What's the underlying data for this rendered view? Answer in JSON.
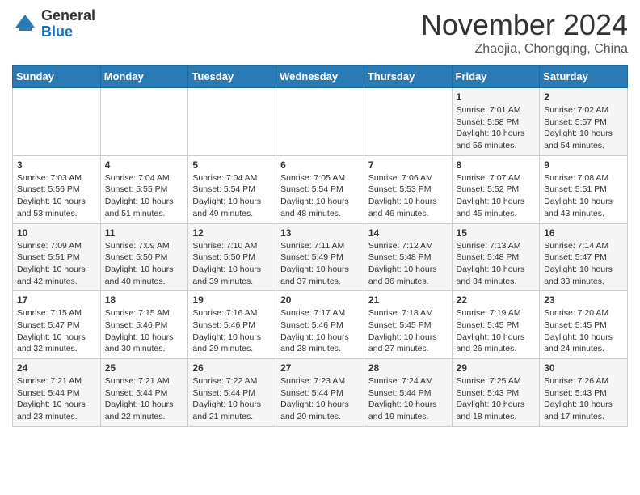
{
  "header": {
    "logo_general": "General",
    "logo_blue": "Blue",
    "month_title": "November 2024",
    "subtitle": "Zhaojia, Chongqing, China"
  },
  "weekdays": [
    "Sunday",
    "Monday",
    "Tuesday",
    "Wednesday",
    "Thursday",
    "Friday",
    "Saturday"
  ],
  "weeks": [
    [
      {
        "day": "",
        "info": ""
      },
      {
        "day": "",
        "info": ""
      },
      {
        "day": "",
        "info": ""
      },
      {
        "day": "",
        "info": ""
      },
      {
        "day": "",
        "info": ""
      },
      {
        "day": "1",
        "info": "Sunrise: 7:01 AM\nSunset: 5:58 PM\nDaylight: 10 hours\nand 56 minutes."
      },
      {
        "day": "2",
        "info": "Sunrise: 7:02 AM\nSunset: 5:57 PM\nDaylight: 10 hours\nand 54 minutes."
      }
    ],
    [
      {
        "day": "3",
        "info": "Sunrise: 7:03 AM\nSunset: 5:56 PM\nDaylight: 10 hours\nand 53 minutes."
      },
      {
        "day": "4",
        "info": "Sunrise: 7:04 AM\nSunset: 5:55 PM\nDaylight: 10 hours\nand 51 minutes."
      },
      {
        "day": "5",
        "info": "Sunrise: 7:04 AM\nSunset: 5:54 PM\nDaylight: 10 hours\nand 49 minutes."
      },
      {
        "day": "6",
        "info": "Sunrise: 7:05 AM\nSunset: 5:54 PM\nDaylight: 10 hours\nand 48 minutes."
      },
      {
        "day": "7",
        "info": "Sunrise: 7:06 AM\nSunset: 5:53 PM\nDaylight: 10 hours\nand 46 minutes."
      },
      {
        "day": "8",
        "info": "Sunrise: 7:07 AM\nSunset: 5:52 PM\nDaylight: 10 hours\nand 45 minutes."
      },
      {
        "day": "9",
        "info": "Sunrise: 7:08 AM\nSunset: 5:51 PM\nDaylight: 10 hours\nand 43 minutes."
      }
    ],
    [
      {
        "day": "10",
        "info": "Sunrise: 7:09 AM\nSunset: 5:51 PM\nDaylight: 10 hours\nand 42 minutes."
      },
      {
        "day": "11",
        "info": "Sunrise: 7:09 AM\nSunset: 5:50 PM\nDaylight: 10 hours\nand 40 minutes."
      },
      {
        "day": "12",
        "info": "Sunrise: 7:10 AM\nSunset: 5:50 PM\nDaylight: 10 hours\nand 39 minutes."
      },
      {
        "day": "13",
        "info": "Sunrise: 7:11 AM\nSunset: 5:49 PM\nDaylight: 10 hours\nand 37 minutes."
      },
      {
        "day": "14",
        "info": "Sunrise: 7:12 AM\nSunset: 5:48 PM\nDaylight: 10 hours\nand 36 minutes."
      },
      {
        "day": "15",
        "info": "Sunrise: 7:13 AM\nSunset: 5:48 PM\nDaylight: 10 hours\nand 34 minutes."
      },
      {
        "day": "16",
        "info": "Sunrise: 7:14 AM\nSunset: 5:47 PM\nDaylight: 10 hours\nand 33 minutes."
      }
    ],
    [
      {
        "day": "17",
        "info": "Sunrise: 7:15 AM\nSunset: 5:47 PM\nDaylight: 10 hours\nand 32 minutes."
      },
      {
        "day": "18",
        "info": "Sunrise: 7:15 AM\nSunset: 5:46 PM\nDaylight: 10 hours\nand 30 minutes."
      },
      {
        "day": "19",
        "info": "Sunrise: 7:16 AM\nSunset: 5:46 PM\nDaylight: 10 hours\nand 29 minutes."
      },
      {
        "day": "20",
        "info": "Sunrise: 7:17 AM\nSunset: 5:46 PM\nDaylight: 10 hours\nand 28 minutes."
      },
      {
        "day": "21",
        "info": "Sunrise: 7:18 AM\nSunset: 5:45 PM\nDaylight: 10 hours\nand 27 minutes."
      },
      {
        "day": "22",
        "info": "Sunrise: 7:19 AM\nSunset: 5:45 PM\nDaylight: 10 hours\nand 26 minutes."
      },
      {
        "day": "23",
        "info": "Sunrise: 7:20 AM\nSunset: 5:45 PM\nDaylight: 10 hours\nand 24 minutes."
      }
    ],
    [
      {
        "day": "24",
        "info": "Sunrise: 7:21 AM\nSunset: 5:44 PM\nDaylight: 10 hours\nand 23 minutes."
      },
      {
        "day": "25",
        "info": "Sunrise: 7:21 AM\nSunset: 5:44 PM\nDaylight: 10 hours\nand 22 minutes."
      },
      {
        "day": "26",
        "info": "Sunrise: 7:22 AM\nSunset: 5:44 PM\nDaylight: 10 hours\nand 21 minutes."
      },
      {
        "day": "27",
        "info": "Sunrise: 7:23 AM\nSunset: 5:44 PM\nDaylight: 10 hours\nand 20 minutes."
      },
      {
        "day": "28",
        "info": "Sunrise: 7:24 AM\nSunset: 5:44 PM\nDaylight: 10 hours\nand 19 minutes."
      },
      {
        "day": "29",
        "info": "Sunrise: 7:25 AM\nSunset: 5:43 PM\nDaylight: 10 hours\nand 18 minutes."
      },
      {
        "day": "30",
        "info": "Sunrise: 7:26 AM\nSunset: 5:43 PM\nDaylight: 10 hours\nand 17 minutes."
      }
    ]
  ]
}
